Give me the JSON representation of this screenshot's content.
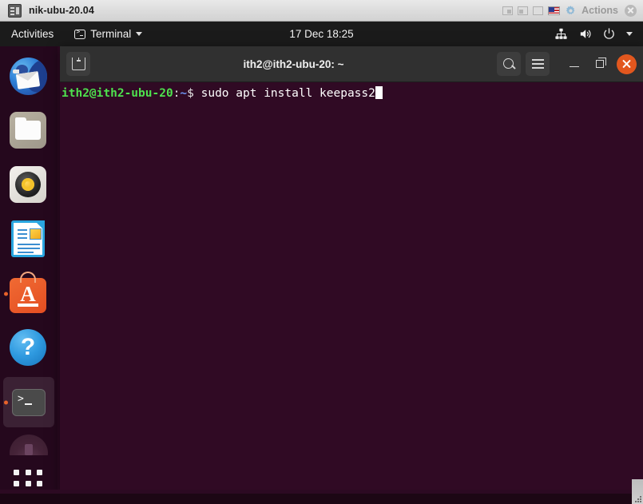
{
  "vm_window": {
    "title": "nik-ubu-20.04",
    "app_icon": "vm-machine-icon",
    "status_icons": [
      "harddisk-icon",
      "network-icon",
      "shared-folder-icon"
    ],
    "keyboard_flag": "us-flag-icon",
    "actions_label": "Actions",
    "gear_icon": "gear-icon",
    "close_icon": "close-icon"
  },
  "topbar": {
    "activities": "Activities",
    "app_menu": {
      "label": "Terminal",
      "icon": "terminal-icon",
      "caret": "chevron-down-icon"
    },
    "clock": "17 Dec  18:25",
    "tray": {
      "network_icon": "wired-network-icon",
      "volume_icon": "volume-icon",
      "power_icon": "power-icon",
      "caret_icon": "chevron-down-icon"
    }
  },
  "dock": {
    "items": [
      {
        "name": "thunderbird",
        "label": "Thunderbird Mail",
        "running": false
      },
      {
        "name": "files",
        "label": "Files",
        "running": false
      },
      {
        "name": "rhythmbox",
        "label": "Rhythmbox",
        "running": false
      },
      {
        "name": "libreoffice-writer",
        "label": "LibreOffice Writer",
        "running": false
      },
      {
        "name": "ubuntu-software",
        "label": "Ubuntu Software",
        "running": true
      },
      {
        "name": "help",
        "label": "Help",
        "running": false
      },
      {
        "name": "terminal",
        "label": "Terminal",
        "running": true
      },
      {
        "name": "disk",
        "label": "Disk",
        "running": false
      }
    ],
    "show_apps_label": "Show Applications"
  },
  "terminal": {
    "title": "ith2@ith2-ubu-20: ~",
    "new_tab_icon": "new-tab-icon",
    "search_icon": "search-icon",
    "menu_icon": "hamburger-menu-icon",
    "minimize_icon": "minimize-icon",
    "maximize_icon": "maximize-icon",
    "close_icon": "close-icon",
    "prompt": {
      "user_host": "ith2@ith2-ubu-20",
      "separator": ":",
      "path": "~",
      "dollar": "$"
    },
    "command": " sudo apt install keepass2",
    "colors": {
      "background": "#300a24",
      "header": "#303030",
      "prompt_user": "#4ee24e",
      "prompt_path": "#6d94f2",
      "close_button": "#e2571e",
      "text": "#ffffff"
    }
  }
}
